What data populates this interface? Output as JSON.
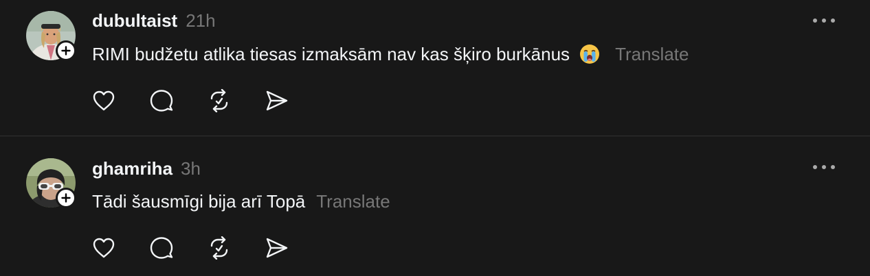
{
  "posts": [
    {
      "username": "dubultaist",
      "time": "21h",
      "text": "RIMI budžetu atlika tiesas izmaksām nav kas šķiro burkānus",
      "emoji": "crying-face-emoji",
      "translate": "Translate",
      "avatar": "user-avatar-photo"
    },
    {
      "username": "ghamriha",
      "time": "3h",
      "text": "Tādi šausmīgi bija arī Topā",
      "translate": "Translate",
      "avatar": "user-avatar-photo"
    }
  ],
  "icons": {
    "follow": "plus-icon",
    "like": "heart-icon",
    "reply": "comment-icon",
    "repost": "repost-icon",
    "share": "send-icon",
    "more": "more-options-icon"
  },
  "colors": {
    "background": "#181818",
    "primary_text": "#f3f5f7",
    "secondary_text": "#777777",
    "divider": "#323232"
  }
}
